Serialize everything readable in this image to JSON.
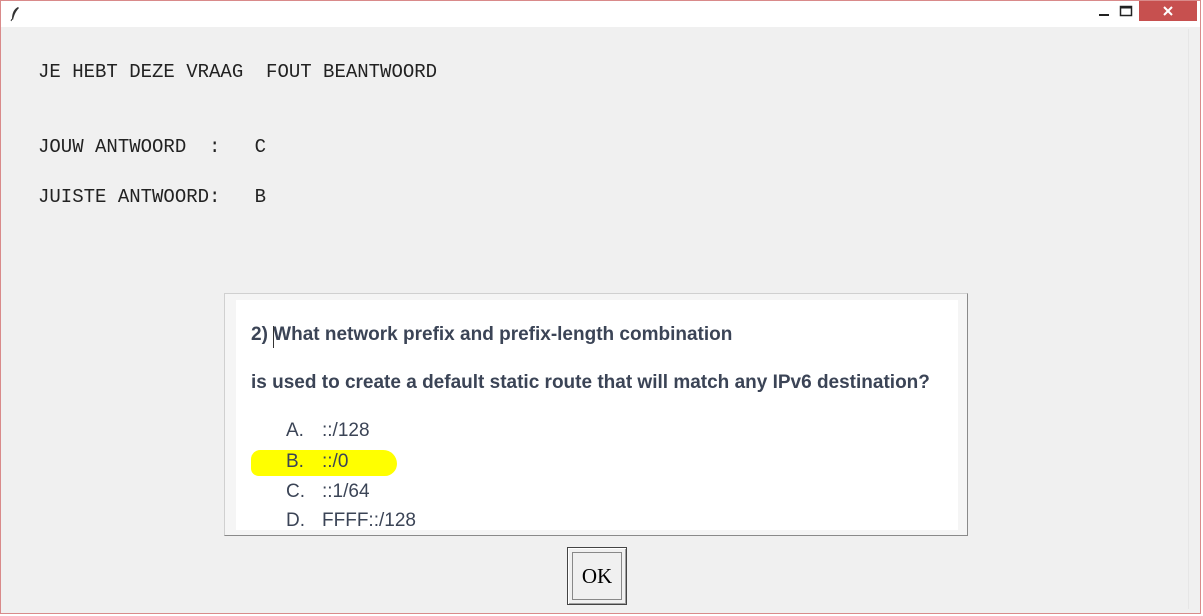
{
  "window": {
    "controls": {
      "minimize": "—",
      "maximize": "☐",
      "close": "✕"
    }
  },
  "feedback": {
    "verdict": "JE HEBT DEZE VRAAG  FOUT BEANTWOORD",
    "your_answer": "JOUW ANTWOORD  :   C",
    "correct_answer": "JUISTE ANTWOORD:   B"
  },
  "question": {
    "line1": "2) What network prefix and prefix-length combination",
    "line2": "is used to create a default static route that will match any IPv6 destination?",
    "options": [
      {
        "letter": "A.",
        "text": "::/128"
      },
      {
        "letter": "B.",
        "text": "::/0"
      },
      {
        "letter": "C.",
        "text": "::1/64"
      },
      {
        "letter": "D.",
        "text": "FFFF::/128"
      }
    ],
    "highlight_color": "#ffff00",
    "highlighted_option": "B."
  },
  "ok_button": {
    "label": "OK"
  },
  "colors": {
    "close_button": "#c7504f",
    "window_bg": "#f0f0f0",
    "question_text": "#3b4456"
  }
}
